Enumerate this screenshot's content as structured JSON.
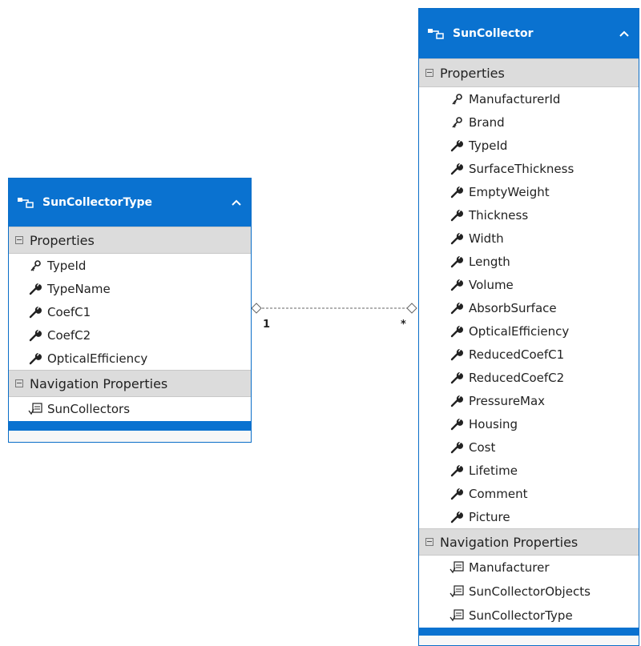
{
  "left_entity": {
    "title": "SunCollectorType",
    "properties_header": "Properties",
    "properties": [
      {
        "name": "TypeId",
        "icon": "key-icon"
      },
      {
        "name": "TypeName",
        "icon": "wrench-icon"
      },
      {
        "name": "CoefC1",
        "icon": "wrench-icon"
      },
      {
        "name": "CoefC2",
        "icon": "wrench-icon"
      },
      {
        "name": "OpticalEfficiency",
        "icon": "wrench-icon"
      }
    ],
    "navigation_header": "Navigation Properties",
    "navigation": [
      {
        "name": "SunCollectors",
        "icon": "navigation-icon"
      }
    ]
  },
  "right_entity": {
    "title": "SunCollector",
    "properties_header": "Properties",
    "properties": [
      {
        "name": "ManufacturerId",
        "icon": "key-icon"
      },
      {
        "name": "Brand",
        "icon": "key-icon"
      },
      {
        "name": "TypeId",
        "icon": "wrench-icon"
      },
      {
        "name": "SurfaceThickness",
        "icon": "wrench-icon"
      },
      {
        "name": "EmptyWeight",
        "icon": "wrench-icon"
      },
      {
        "name": "Thickness",
        "icon": "wrench-icon"
      },
      {
        "name": "Width",
        "icon": "wrench-icon"
      },
      {
        "name": "Length",
        "icon": "wrench-icon"
      },
      {
        "name": "Volume",
        "icon": "wrench-icon"
      },
      {
        "name": "AbsorbSurface",
        "icon": "wrench-icon"
      },
      {
        "name": "OpticalEfficiency",
        "icon": "wrench-icon"
      },
      {
        "name": "ReducedCoefC1",
        "icon": "wrench-icon"
      },
      {
        "name": "ReducedCoefC2",
        "icon": "wrench-icon"
      },
      {
        "name": "PressureMax",
        "icon": "wrench-icon"
      },
      {
        "name": "Housing",
        "icon": "wrench-icon"
      },
      {
        "name": "Cost",
        "icon": "wrench-icon"
      },
      {
        "name": "Lifetime",
        "icon": "wrench-icon"
      },
      {
        "name": "Comment",
        "icon": "wrench-icon"
      },
      {
        "name": "Picture",
        "icon": "wrench-icon"
      }
    ],
    "navigation_header": "Navigation Properties",
    "navigation": [
      {
        "name": "Manufacturer",
        "icon": "navigation-icon"
      },
      {
        "name": "SunCollectorObjects",
        "icon": "navigation-icon"
      },
      {
        "name": "SunCollectorType",
        "icon": "navigation-icon"
      }
    ]
  },
  "association": {
    "left_multiplicity": "1",
    "right_multiplicity": "*"
  },
  "colors": {
    "header_blue": "#0a72d0",
    "section_gray": "#dcdcdc"
  }
}
